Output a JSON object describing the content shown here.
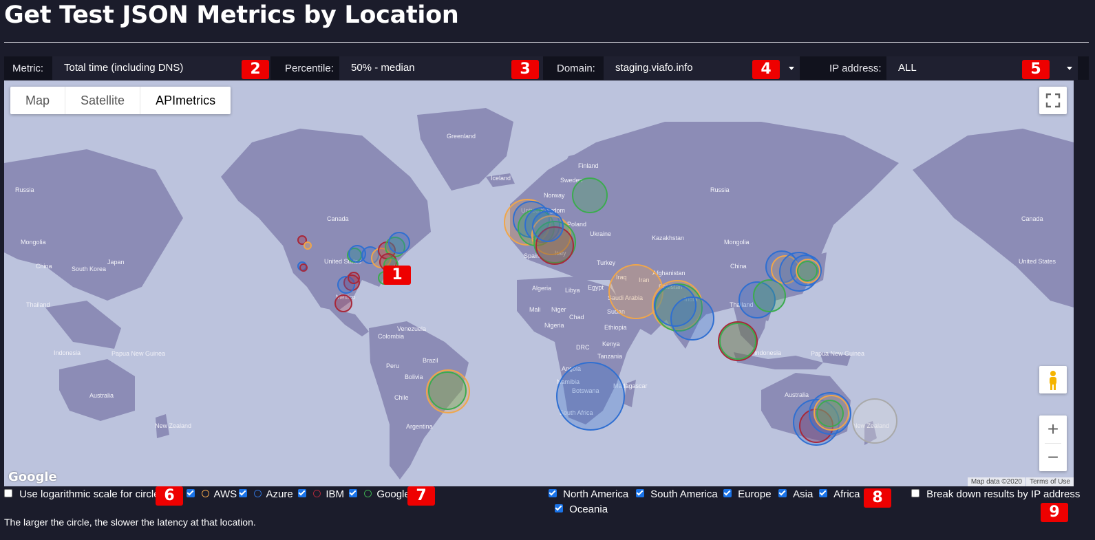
{
  "page": {
    "title": "Get Test JSON Metrics by Location"
  },
  "filters": {
    "metric": {
      "label": "Metric:",
      "value": "Total time (including DNS)"
    },
    "percentile": {
      "label": "Percentile:",
      "value": "50% - median"
    },
    "domain": {
      "label": "Domain:",
      "value": "staging.viafo.info"
    },
    "ip_address": {
      "label": "IP address:",
      "value": "ALL"
    }
  },
  "badges": [
    "1",
    "2",
    "3",
    "4",
    "5",
    "6",
    "7",
    "8",
    "9"
  ],
  "map": {
    "type_buttons": [
      "Map",
      "Satellite",
      "APImetrics"
    ],
    "active_type": "APImetrics",
    "logo": "Google",
    "attribution": "Map data ©2020",
    "terms": "Terms of Use",
    "zoom_in": "+",
    "zoom_out": "−",
    "country_labels": [
      "Greenland",
      "Iceland",
      "Finland",
      "Sweden",
      "Norway",
      "Russia",
      "Russia",
      "Canada",
      "Canada",
      "United States",
      "United States",
      "Mexico",
      "Mongolia",
      "Mongolia",
      "China",
      "China",
      "South Korea",
      "Japan",
      "Thailand",
      "Thailand",
      "Indonesia",
      "Indonesia",
      "Papua New Guinea",
      "Papua New Guinea",
      "Australia",
      "Australia",
      "New Zealand",
      "New Zealand",
      "Ukraine",
      "Kazakhstan",
      "Turkey",
      "Afghanistan",
      "Iraq",
      "Iran",
      "Saudi Arabia",
      "Pakistan",
      "India",
      "Spain",
      "Poland",
      "Italy",
      "Algeria",
      "Libya",
      "Egypt",
      "Mali",
      "Niger",
      "Chad",
      "Sudan",
      "Nigeria",
      "Ethiopia",
      "DRC",
      "Kenya",
      "Tanzania",
      "Angola",
      "Namibia",
      "Botswana",
      "Madagascar",
      "South Africa",
      "Venezuela",
      "Colombia",
      "Brazil",
      "Peru",
      "Bolivia",
      "Chile",
      "Argentina",
      "United Kingdom"
    ]
  },
  "legend": {
    "log_scale": {
      "label": "Use logarithmic scale for circles",
      "checked": false
    },
    "providers": [
      {
        "name": "AWS",
        "color": "#f0a64a",
        "checked": true
      },
      {
        "name": "Azure",
        "color": "#2f6fd1",
        "checked": true
      },
      {
        "name": "IBM",
        "color": "#a8283a",
        "checked": true
      },
      {
        "name": "Google",
        "color": "#3cab4f",
        "checked": true
      }
    ],
    "regions": [
      {
        "name": "North America",
        "checked": true
      },
      {
        "name": "South America",
        "checked": true
      },
      {
        "name": "Europe",
        "checked": true
      },
      {
        "name": "Asia",
        "checked": true
      },
      {
        "name": "Africa",
        "checked": true
      },
      {
        "name": "Oceania",
        "checked": true
      }
    ],
    "breakdown": {
      "label": "Break down results by IP address",
      "checked": false
    }
  },
  "footnote": "The larger the circle, the slower the latency at that location.",
  "colors": {
    "background": "#1b1c2b",
    "ocean": "#bcc3dd",
    "land": "#8c8cb6",
    "badge": "#ee0000"
  }
}
